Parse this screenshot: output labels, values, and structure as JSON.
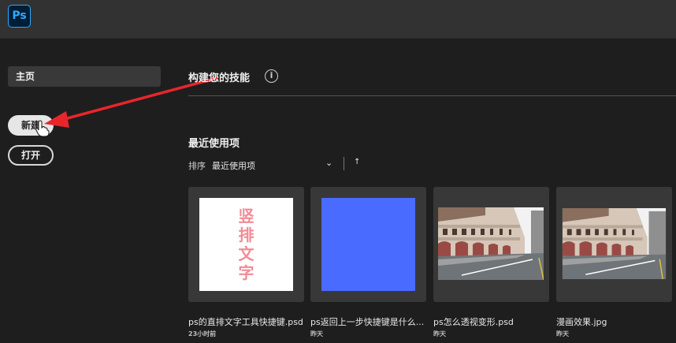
{
  "app": {
    "logo": "Ps"
  },
  "sidebar": {
    "home_label": "主页",
    "new_label": "新建",
    "open_label": "打开"
  },
  "main": {
    "skills_title": "构建您的技能",
    "info_glyph": "i",
    "recent_title": "最近使用项",
    "sort_label": "排序",
    "sort_value": "最近使用项",
    "sort_chevron": "⌄",
    "sort_direction": "↑"
  },
  "files": [
    {
      "name": "ps的直排文字工具快捷键.psd",
      "time": "23小时前",
      "thumb_text": "竖排文字",
      "thumb_type": "text"
    },
    {
      "name": "ps返回上一步快捷键是什么...",
      "time": "昨天",
      "thumb_type": "blue"
    },
    {
      "name": "ps怎么透视变形.psd",
      "time": "昨天",
      "thumb_type": "photo"
    },
    {
      "name": "漫画效果.jpg",
      "time": "昨天",
      "thumb_type": "photo"
    }
  ],
  "colors": {
    "annotation_arrow": "#e8262a",
    "blue_thumb": "#4a6bff",
    "vertical_text": "#f28b95",
    "ps_blue": "#31a8ff"
  }
}
